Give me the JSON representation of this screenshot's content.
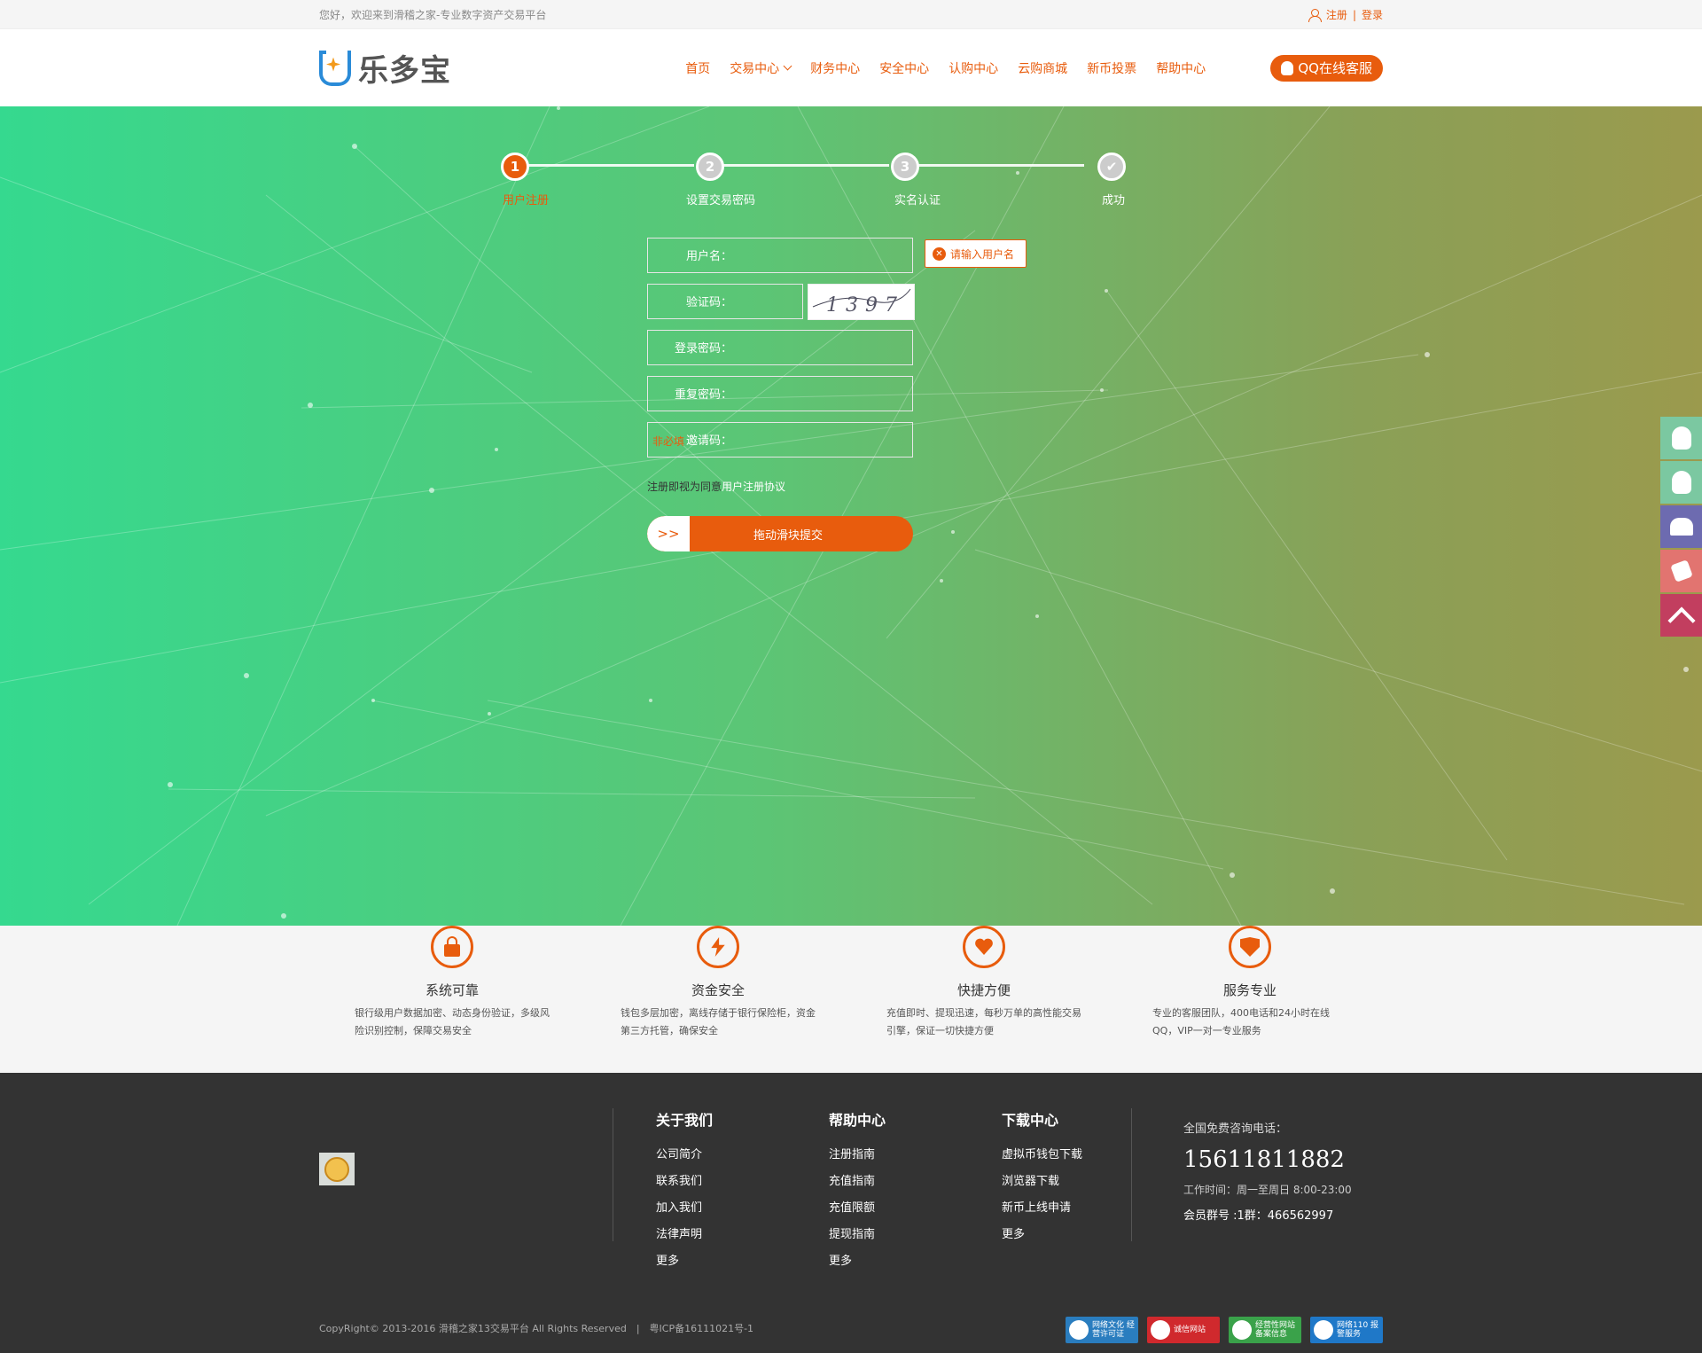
{
  "topbar": {
    "welcome": "您好，欢迎来到滑稽之家-专业数字资产交易平台",
    "register": "注册",
    "sep": "|",
    "login": "登录"
  },
  "header": {
    "logo_text": "乐多宝",
    "nav": [
      "首页",
      "交易中心",
      "财务中心",
      "安全中心",
      "认购中心",
      "云购商城",
      "新币投票",
      "帮助中心"
    ],
    "qq_service": "QQ在线客服"
  },
  "steps": [
    {
      "num": "1",
      "label": "用户注册",
      "active": true
    },
    {
      "num": "2",
      "label": "设置交易密码",
      "active": false
    },
    {
      "num": "3",
      "label": "实名认证",
      "active": false
    },
    {
      "num": "✔",
      "label": "成功",
      "active": false
    }
  ],
  "form": {
    "username_label": "用户名：",
    "username_error": "请输入用户名",
    "captcha_label": "验证码：",
    "captcha_text": "1397",
    "password_label": "登录密码：",
    "repeat_label": "重复密码：",
    "invite_label": "邀请码：",
    "invite_placeholder": "非必填",
    "agree_prefix": "注册即视为同意",
    "agree_link": "用户注册协议",
    "slider_handle": ">>",
    "slider_text": "拖动滑块提交"
  },
  "features": [
    {
      "title": "系统可靠",
      "desc": "银行级用户数据加密、动态身份验证，多级风险识别控制，保障交易安全"
    },
    {
      "title": "资金安全",
      "desc": "钱包多层加密，离线存储于银行保险柜，资金第三方托管，确保安全"
    },
    {
      "title": "快捷方便",
      "desc": "充值即时、提现迅速，每秒万单的高性能交易引擎，保证一切快捷方便"
    },
    {
      "title": "服务专业",
      "desc": "专业的客服团队，400电话和24小时在线QQ，VIP一对一专业服务"
    }
  ],
  "footer": {
    "cols": [
      {
        "title": "关于我们",
        "links": [
          "公司简介",
          "联系我们",
          "加入我们",
          "法律声明",
          "更多"
        ]
      },
      {
        "title": "帮助中心",
        "links": [
          "注册指南",
          "充值指南",
          "充值限额",
          "提现指南",
          "更多"
        ]
      },
      {
        "title": "下载中心",
        "links": [
          "虚拟币钱包下载",
          "浏览器下载",
          "新币上线申请",
          "更多"
        ]
      }
    ],
    "contact_label": "全国免费咨询电话：",
    "phone": "15611811882",
    "hours": "工作时间：周一至周日 8:00-23:00",
    "group": "会员群号 :1群：466562997",
    "copyright": "CopyRight© 2013-2016 滑稽之家13交易平台 All Rights Reserved　|　粤ICP备16111021号-1",
    "badges": [
      {
        "text": "网络文化 经营许可证",
        "color": "#2a7dbf"
      },
      {
        "text": "诚信网站",
        "color": "#d0292d"
      },
      {
        "text": "经营性网站 备案信息",
        "color": "#3aa24a"
      },
      {
        "text": "网络110 报警服务",
        "color": "#1f78c8"
      }
    ]
  }
}
